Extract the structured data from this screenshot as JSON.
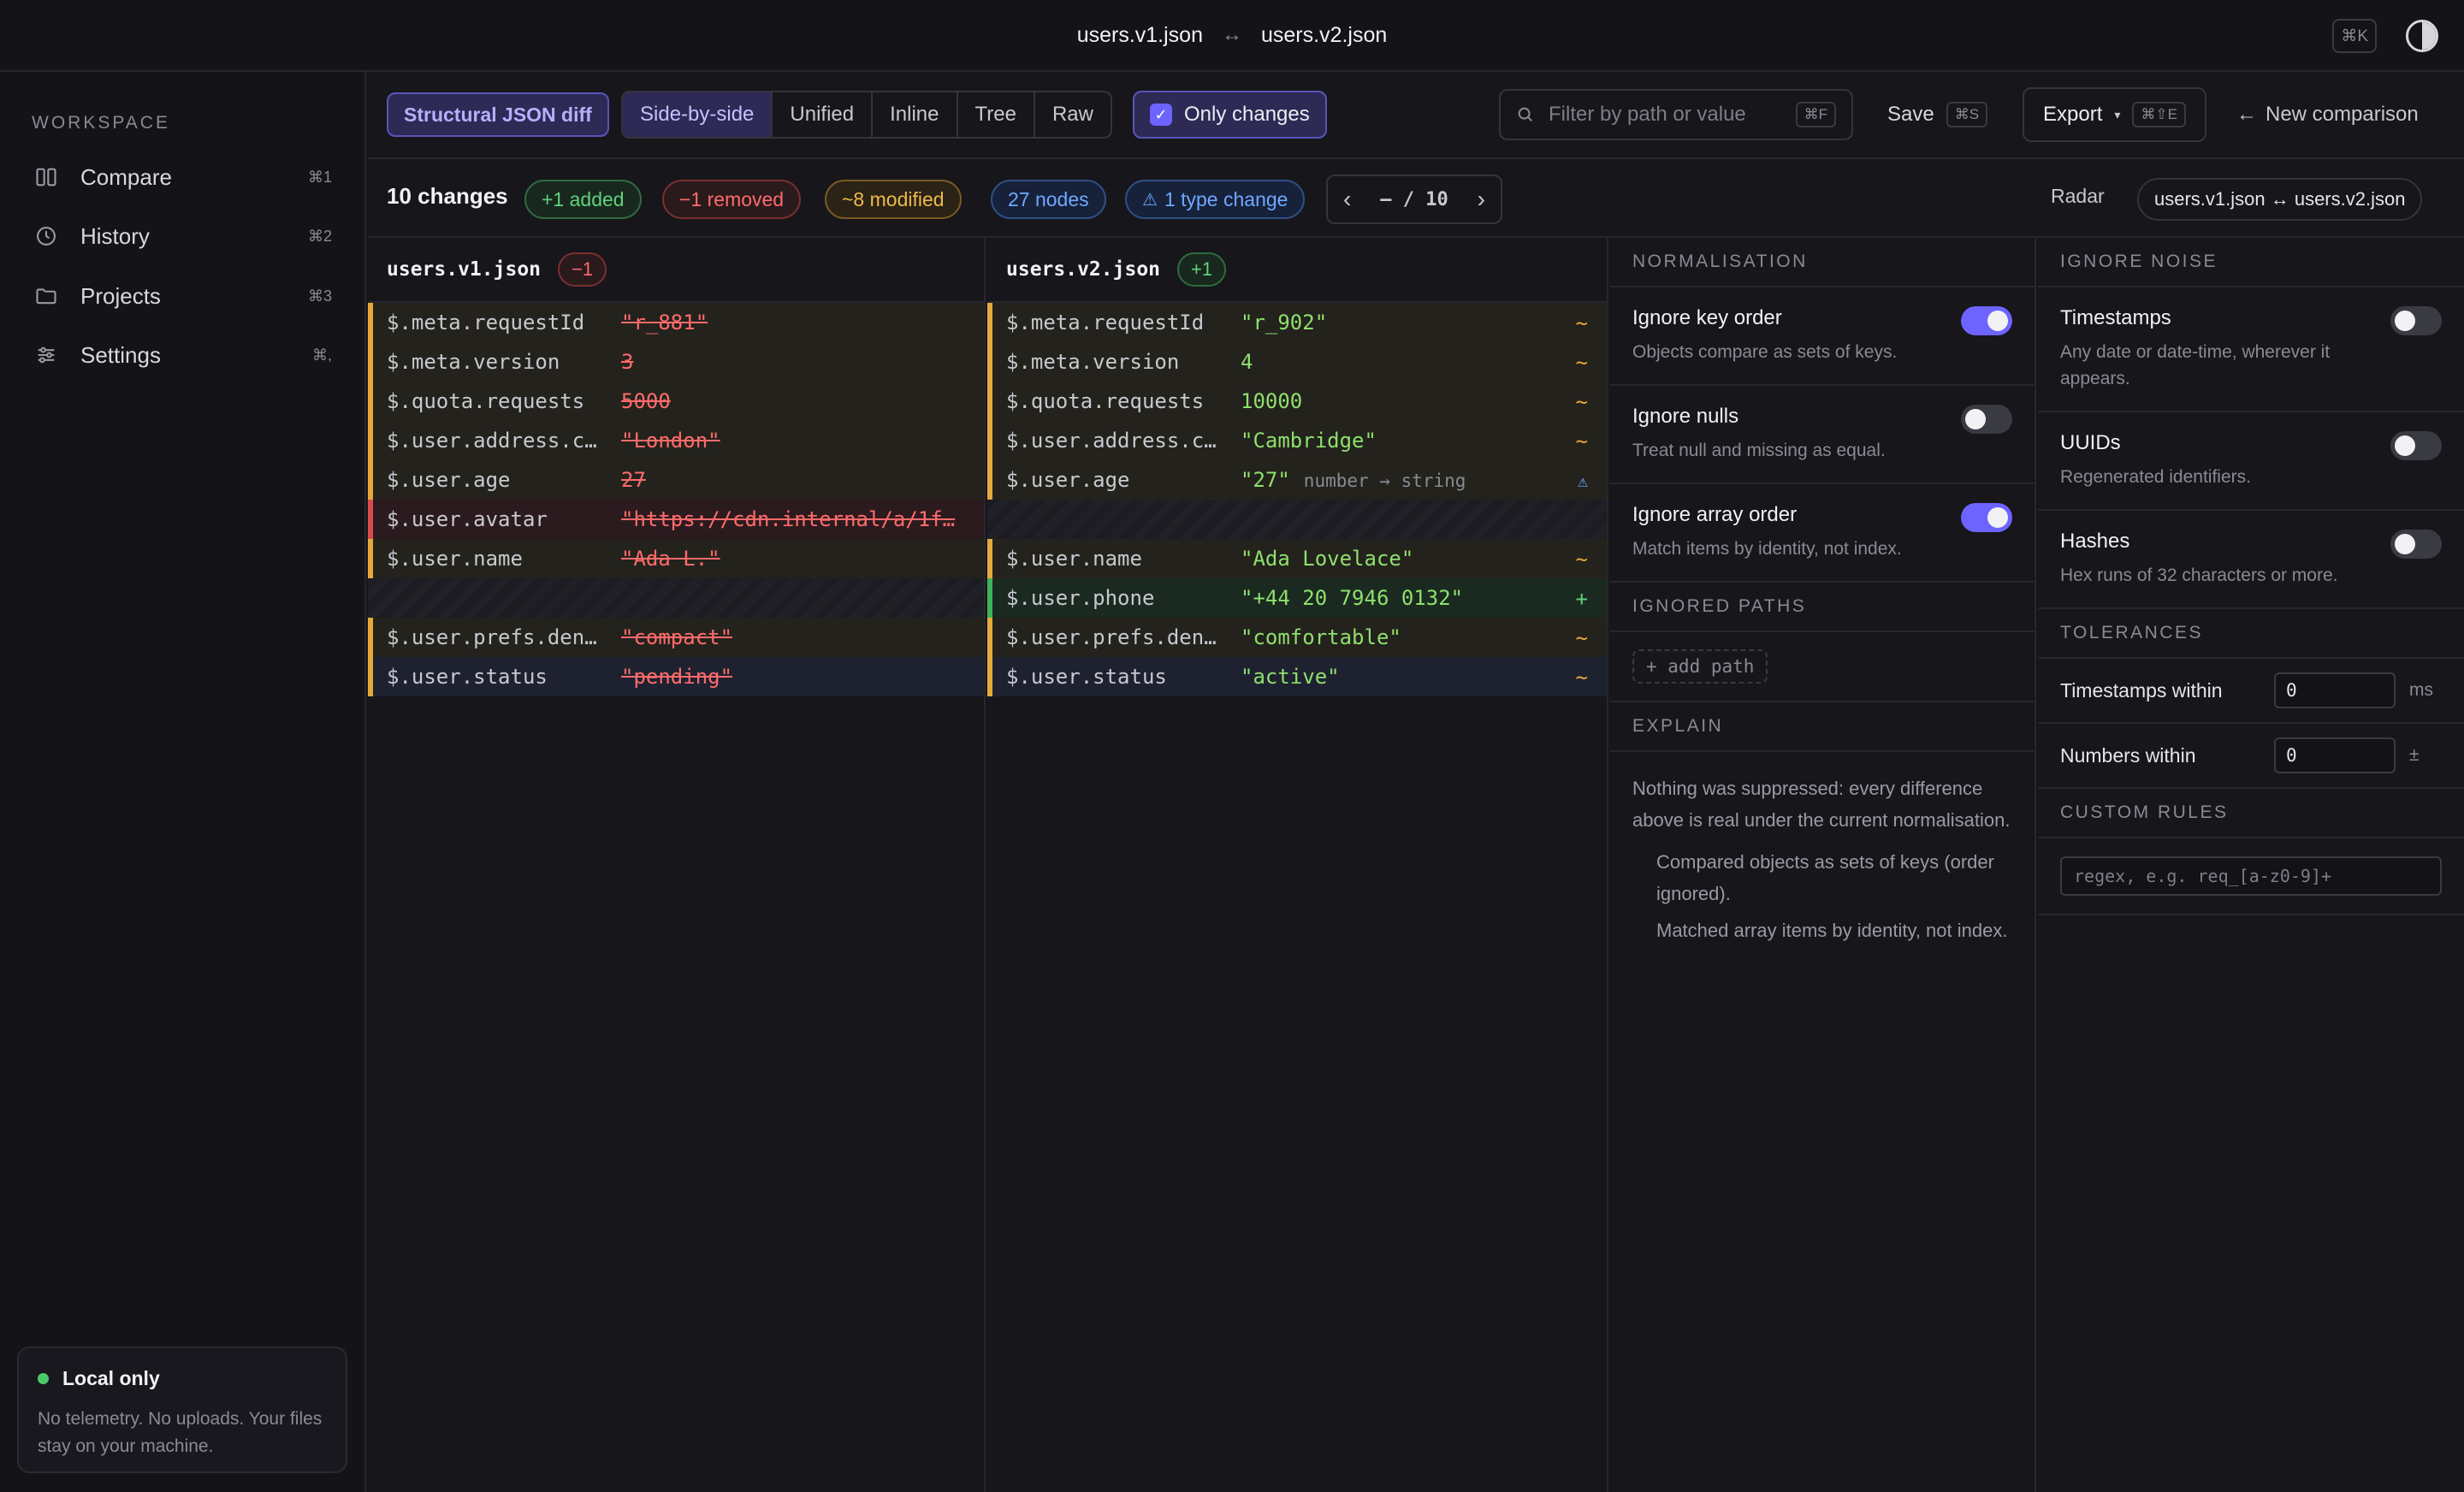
{
  "titlebar": {
    "left_file": "users.v1.json",
    "arrow": "↔",
    "right_file": "users.v2.json",
    "shortcut": "⌘K",
    "theme_icon": "contrast-icon"
  },
  "sidebar": {
    "heading": "WORKSPACE",
    "items": [
      {
        "label": "Compare",
        "shortcut": "⌘1",
        "icon": "columns-icon"
      },
      {
        "label": "History",
        "shortcut": "⌘2",
        "icon": "clock-icon"
      },
      {
        "label": "Projects",
        "shortcut": "⌘3",
        "icon": "folder-icon"
      },
      {
        "label": "Settings",
        "shortcut": "⌘,",
        "icon": "sliders-icon"
      }
    ],
    "privacy": {
      "title": "Local only",
      "text": "No telemetry. No uploads. Your files stay on your machine."
    }
  },
  "toolbar": {
    "mode": "Structural JSON diff",
    "views": [
      "Side-by-side",
      "Unified",
      "Inline",
      "Tree",
      "Raw"
    ],
    "active_view": "Side-by-side",
    "only_changes": "Only changes",
    "only_changes_checked": true,
    "filter_placeholder": "Filter by path or value",
    "filter_shortcut": "⌘F",
    "save": "Save",
    "save_shortcut": "⌘S",
    "export": "Export",
    "export_caret": "▾",
    "export_shortcut": "⌘⇧E",
    "new_comparison": "New comparison",
    "new_comparison_arrow": "←"
  },
  "summary": {
    "count": "10 changes",
    "added": "+1 added",
    "removed": "−1 removed",
    "modified": "~8 modified",
    "nodes": "27 nodes",
    "type_change": "1 type change",
    "type_change_icon": "⚠",
    "nav_prev": "‹",
    "nav_pos": "– / 10",
    "nav_next": "›",
    "radar": "Radar",
    "pair": "users.v1.json ↔ users.v2.json"
  },
  "diff": {
    "left": {
      "file": "users.v1.json",
      "badge": "−1"
    },
    "right": {
      "file": "users.v2.json",
      "badge": "+1"
    },
    "rows": [
      {
        "kind": "mod",
        "lpath": "$.meta.requestId",
        "lval": "\"r_881\"",
        "rpath": "$.meta.requestId",
        "rval": "\"r_902\"",
        "mark": "~"
      },
      {
        "kind": "mod",
        "lpath": "$.meta.version",
        "lval": "3",
        "rpath": "$.meta.version",
        "rval": "4",
        "mark": "~"
      },
      {
        "kind": "mod",
        "lpath": "$.quota.requests",
        "lval": "5000",
        "rpath": "$.quota.requests",
        "rval": "10000",
        "mark": "~"
      },
      {
        "kind": "mod",
        "lpath": "$.user.address.c…",
        "lval": "\"London\"",
        "rpath": "$.user.address.c…",
        "rval": "\"Cambridge\"",
        "mark": "~"
      },
      {
        "kind": "type",
        "lpath": "$.user.age",
        "lval": "27",
        "rpath": "$.user.age",
        "rval": "\"27\"",
        "hint": "number → string",
        "mark": "⚠"
      },
      {
        "kind": "del",
        "lpath": "$.user.avatar",
        "lval": "\"https://cdn.internal/a/1f…",
        "rpath": "",
        "rval": "",
        "mark": ""
      },
      {
        "kind": "mod",
        "lpath": "$.user.name",
        "lval": "\"Ada L.\"",
        "rpath": "$.user.name",
        "rval": "\"Ada Lovelace\"",
        "mark": "~"
      },
      {
        "kind": "ins",
        "lpath": "",
        "lval": "",
        "rpath": "$.user.phone",
        "rval": "\"+44 20 7946 0132\"",
        "mark": "+"
      },
      {
        "kind": "mod",
        "lpath": "$.user.prefs.den…",
        "lval": "\"compact\"",
        "rpath": "$.user.prefs.den…",
        "rval": "\"comfortable\"",
        "mark": "~"
      },
      {
        "kind": "cur",
        "lpath": "$.user.status",
        "lval": "\"pending\"",
        "rpath": "$.user.status",
        "rval": "\"active\"",
        "mark": "~"
      }
    ]
  },
  "normalisation": {
    "heading": "NORMALISATION",
    "options": [
      {
        "title": "Ignore key order",
        "desc": "Objects compare as sets of keys.",
        "on": true
      },
      {
        "title": "Ignore nulls",
        "desc": "Treat null and missing as equal.",
        "on": false
      },
      {
        "title": "Ignore array order",
        "desc": "Match items by identity, not index.",
        "on": true
      }
    ],
    "ignored_paths_heading": "IGNORED PATHS",
    "add_path": "+ add path",
    "explain_heading": "EXPLAIN",
    "explain_text": "Nothing was suppressed: every difference above is real under the current normalisation.",
    "explain_items": [
      "Compared objects as sets of keys (order ignored).",
      "Matched array items by identity, not index."
    ]
  },
  "noise": {
    "heading": "IGNORE NOISE",
    "options": [
      {
        "title": "Timestamps",
        "desc": "Any date or date-time, wherever it appears.",
        "on": false
      },
      {
        "title": "UUIDs",
        "desc": "Regenerated identifiers.",
        "on": false
      },
      {
        "title": "Hashes",
        "desc": "Hex runs of 32 characters or more.",
        "on": false
      }
    ],
    "tolerances_heading": "TOLERANCES",
    "tolerances": [
      {
        "label": "Timestamps within",
        "value": "0",
        "unit": "ms"
      },
      {
        "label": "Numbers within",
        "value": "0",
        "unit": "±"
      }
    ],
    "custom_rules_heading": "CUSTOM RULES",
    "custom_rules_placeholder": "regex, e.g. req_[a-z0-9]+"
  }
}
